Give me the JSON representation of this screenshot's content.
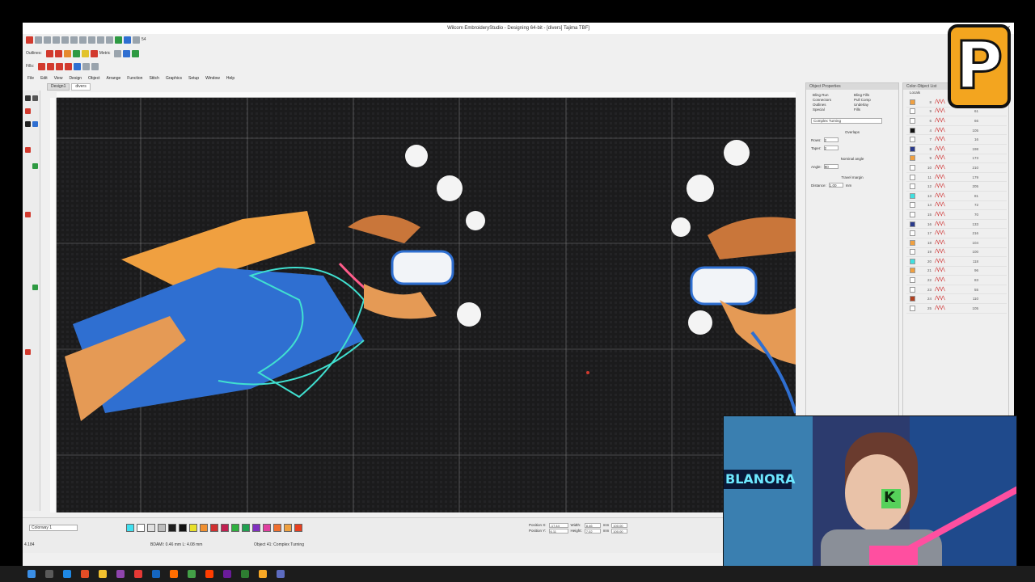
{
  "window": {
    "title": "Wilcom EmbroideryStudio - Designing 64-bit - [divers]   Tajima TBF]"
  },
  "toolbar": {
    "outlines_label": "Outlines:",
    "fills_label": "Fills:",
    "metric_label": "Metric",
    "zoom_value": "54"
  },
  "menu": [
    "File",
    "Edit",
    "View",
    "Design",
    "Object",
    "Arrange",
    "Function",
    "Stitch",
    "Graphics",
    "Setup",
    "Window",
    "Help"
  ],
  "doc_tabs": [
    "Design1",
    "divers"
  ],
  "object_properties": {
    "title": "Object Properties",
    "tabs": [
      "Bling Run",
      "Bling Fills",
      "Connectors",
      "Pull Comp",
      "Outlines",
      "Underlay",
      "Special",
      "Fills"
    ],
    "stitch_type": "Complex Turning",
    "overlaps_label": "Overlaps",
    "rows_label": "Rows:",
    "rows_value": "2",
    "taper_label": "Taper:",
    "taper_value": "2",
    "nominal_angle_label": "Nominal angle",
    "angle_label": "Angle:",
    "angle_value": "90",
    "travel_margin_label": "Travel margin",
    "distance_label": "Distance:",
    "distance_value": "1.00",
    "distance_unit": "mm"
  },
  "object_list": {
    "title": "Color-Object List",
    "tab_label": "Locals",
    "rows": [
      {
        "swatch": "#f0a040",
        "num": "8",
        "count": "46"
      },
      {
        "swatch": "#ffffff",
        "num": "9",
        "count": "61"
      },
      {
        "swatch": "#ffffff",
        "num": "6",
        "count": "66"
      },
      {
        "swatch": "#111111",
        "num": "4",
        "count": "105"
      },
      {
        "swatch": "#ffffff",
        "num": "7",
        "count": "16"
      },
      {
        "swatch": "#2a3a8c",
        "num": "8",
        "count": "198"
      },
      {
        "swatch": "#f0a040",
        "num": "9",
        "count": "173"
      },
      {
        "swatch": "#ffffff",
        "num": "10",
        "count": "210"
      },
      {
        "swatch": "#ffffff",
        "num": "11",
        "count": "179"
      },
      {
        "swatch": "#ffffff",
        "num": "12",
        "count": "205"
      },
      {
        "swatch": "#40e0e0",
        "num": "13",
        "count": "81"
      },
      {
        "swatch": "#ffffff",
        "num": "14",
        "count": "72"
      },
      {
        "swatch": "#ffffff",
        "num": "15",
        "count": "70"
      },
      {
        "swatch": "#2a3a8c",
        "num": "16",
        "count": "133"
      },
      {
        "swatch": "#ffffff",
        "num": "17",
        "count": "216"
      },
      {
        "swatch": "#f0a040",
        "num": "18",
        "count": "104"
      },
      {
        "swatch": "#ffffff",
        "num": "19",
        "count": "100"
      },
      {
        "swatch": "#40e0e0",
        "num": "20",
        "count": "118"
      },
      {
        "swatch": "#f0a040",
        "num": "21",
        "count": "96"
      },
      {
        "swatch": "#ffffff",
        "num": "22",
        "count": "83"
      },
      {
        "swatch": "#ffffff",
        "num": "23",
        "count": "55"
      },
      {
        "swatch": "#b04020",
        "num": "24",
        "count": "110"
      },
      {
        "swatch": "#ffffff",
        "num": "25",
        "count": "105"
      }
    ]
  },
  "bottom": {
    "colorway": "Colorway 1",
    "palette": [
      "#40e0f0",
      "#ffffff",
      "#e0e0e0",
      "#bdbdbd",
      "#1e1e1e",
      "#111111",
      "#e8e02a",
      "#f09030",
      "#d03030",
      "#c02050",
      "#30b040",
      "#20a050",
      "#8030c0",
      "#e040a0",
      "#f07030",
      "#f0a040",
      "#e84020"
    ],
    "position_x_label": "Position X:",
    "position_x": "-17.44",
    "position_y_label": "Position Y:",
    "position_y": "6.11",
    "width_label": "Width:",
    "width": "8.46",
    "height_label": "Height:",
    "height": "7.02",
    "scale_w": "100.00",
    "scale_h": "100.00",
    "unit": "mm",
    "coords": "4.184",
    "status_left": "BDAMI: 0.46 mm  L: 4.08 mm",
    "status_right": "Object 41: Complex Turning"
  },
  "overlay": {
    "logo_letter": "P",
    "webcam_sign": "BLANORA",
    "webcam_badge": "K"
  },
  "colors": {
    "canvas": "#1b1b1c",
    "thread_orange": "#f0a040",
    "thread_blue": "#2f6fd1",
    "selection": "#40e0d0",
    "accent_red": "#d23a2e"
  }
}
